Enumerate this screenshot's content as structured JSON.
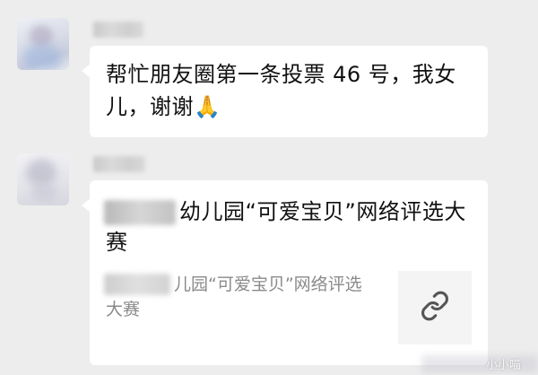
{
  "messages": [
    {
      "sender": "",
      "text": "帮忙朋友圈第一条投票 46 号，我女儿，谢谢🙏"
    },
    {
      "sender": "",
      "link_card": {
        "title": "幼儿园“可爱宝贝”网络评选大赛",
        "description": "儿园“可爱宝贝”网络评选大赛",
        "thumbnail_icon": "link-icon"
      }
    }
  ],
  "watermark": "小小喵",
  "colors": {
    "background": "#ededed",
    "bubble": "#ffffff",
    "text": "#111111",
    "secondary_text": "#8a8a8a"
  }
}
